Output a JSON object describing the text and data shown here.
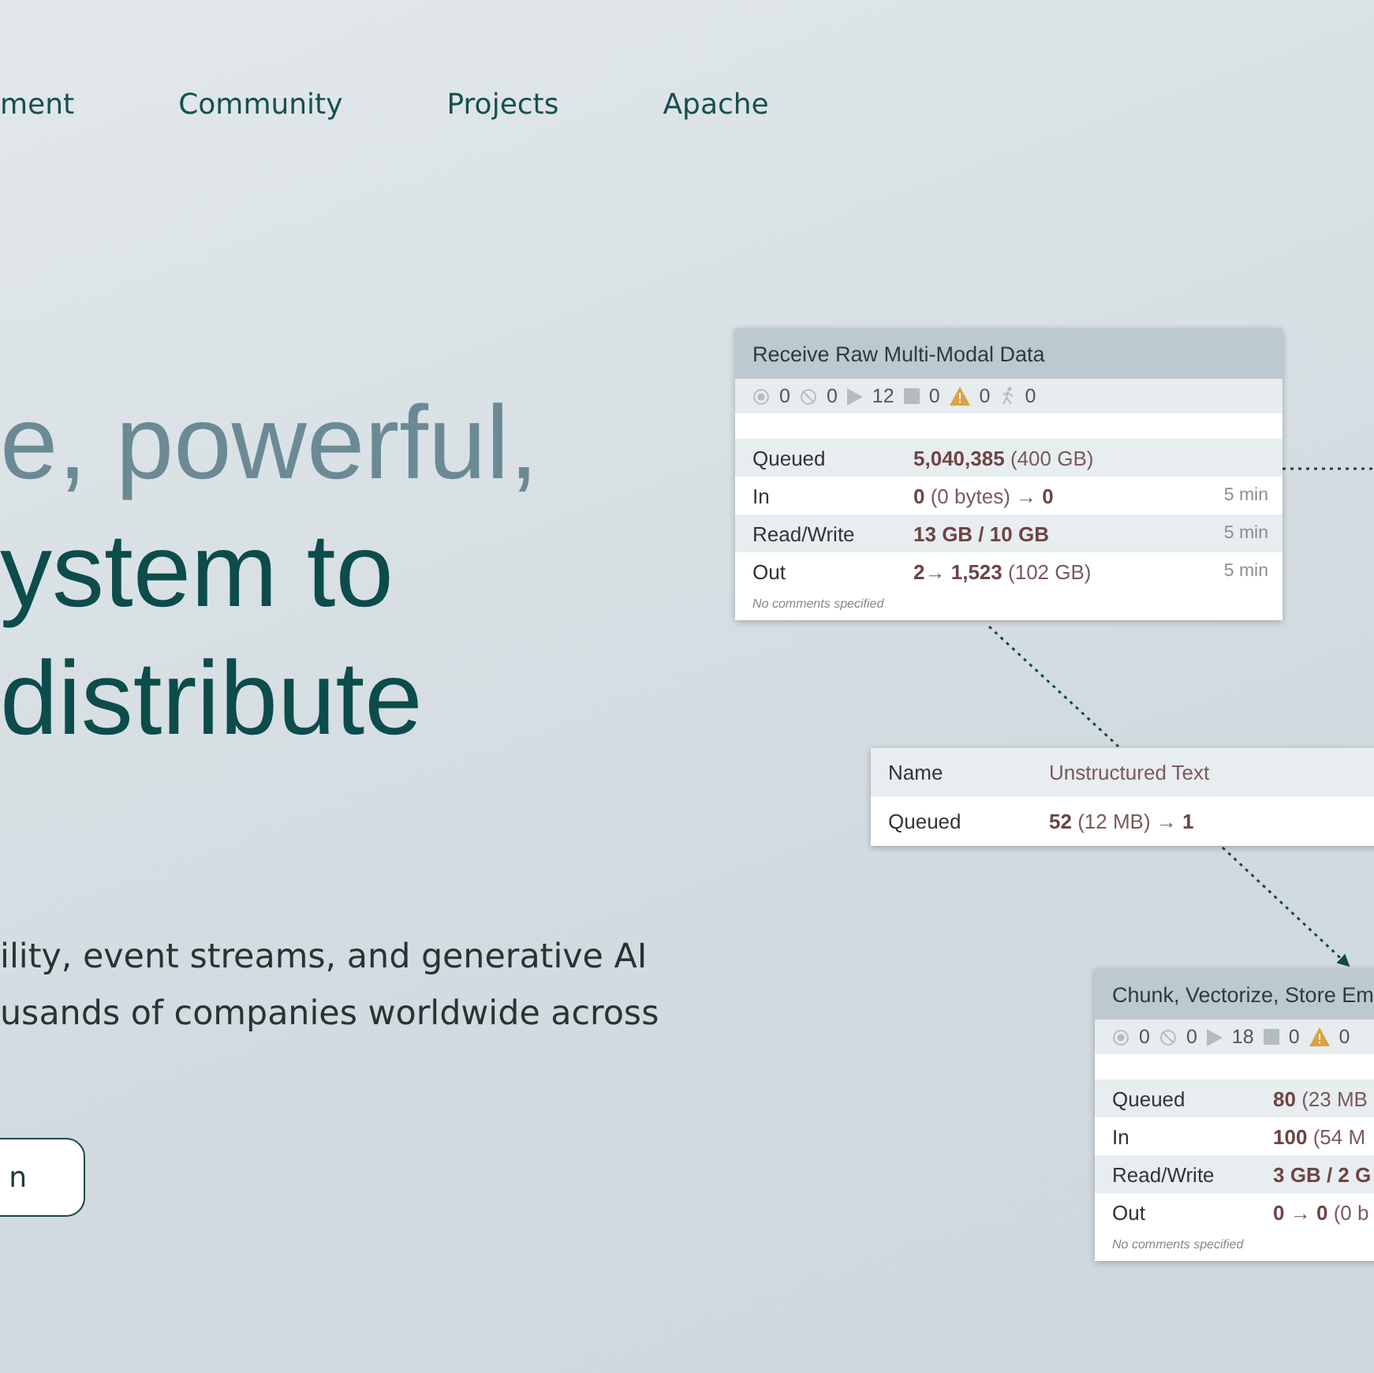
{
  "nav": [
    {
      "label": "ment"
    },
    {
      "label": "Community"
    },
    {
      "label": "Projects"
    },
    {
      "label": "Apache"
    }
  ],
  "headline": [
    {
      "text": "e, powerful,",
      "kind": "muted"
    },
    {
      "text": "ystem to",
      "kind": "strong"
    },
    {
      "text": "distribute",
      "kind": "strong"
    }
  ],
  "paragraph": [
    "ility, event streams, and generative AI",
    "usands of companies worldwide across"
  ],
  "button": {
    "label": "n"
  },
  "nodes": [
    {
      "title": "Receive Raw Multi-Modal Data",
      "stats": [
        {
          "kind": "target",
          "value": "0"
        },
        {
          "kind": "disabled",
          "value": "0"
        },
        {
          "kind": "running",
          "value": "12"
        },
        {
          "kind": "stopped",
          "value": "0"
        },
        {
          "kind": "warning",
          "value": "0"
        },
        {
          "kind": "figure",
          "value": "0"
        }
      ],
      "rows": [
        {
          "label": "Queued",
          "value": "**5,040,385** (400 GB)"
        },
        {
          "label": "In",
          "value": "**0** (0 bytes) → **0**",
          "time": "5 min"
        },
        {
          "label": "Read/Write",
          "value": "**13 GB / 10 GB**",
          "time": "5 min"
        },
        {
          "label": "Out",
          "value": "**2**→ **1,523** (102 GB)",
          "time": "5 min"
        }
      ],
      "comment": "No comments specified"
    },
    {
      "title": "Chunk, Vectorize, Store Em",
      "stats": [
        {
          "kind": "target",
          "value": "0"
        },
        {
          "kind": "disabled",
          "value": "0"
        },
        {
          "kind": "running",
          "value": "18"
        },
        {
          "kind": "stopped",
          "value": "0"
        },
        {
          "kind": "warning",
          "value": "0"
        }
      ],
      "rows": [
        {
          "label": "Queued",
          "value": "**80** (23 MB"
        },
        {
          "label": "In",
          "value": "**100** (54 M"
        },
        {
          "label": "Read/Write",
          "value": "**3 GB / 2 G**"
        },
        {
          "label": "Out",
          "value": "**0** → **0** (0 b"
        }
      ],
      "comment": "No comments specified"
    }
  ],
  "connection": {
    "rows": [
      {
        "label": "Name",
        "value": "Unstructured Text"
      },
      {
        "label": "Queued",
        "value": "**52** (12 MB) → **1**"
      }
    ]
  }
}
